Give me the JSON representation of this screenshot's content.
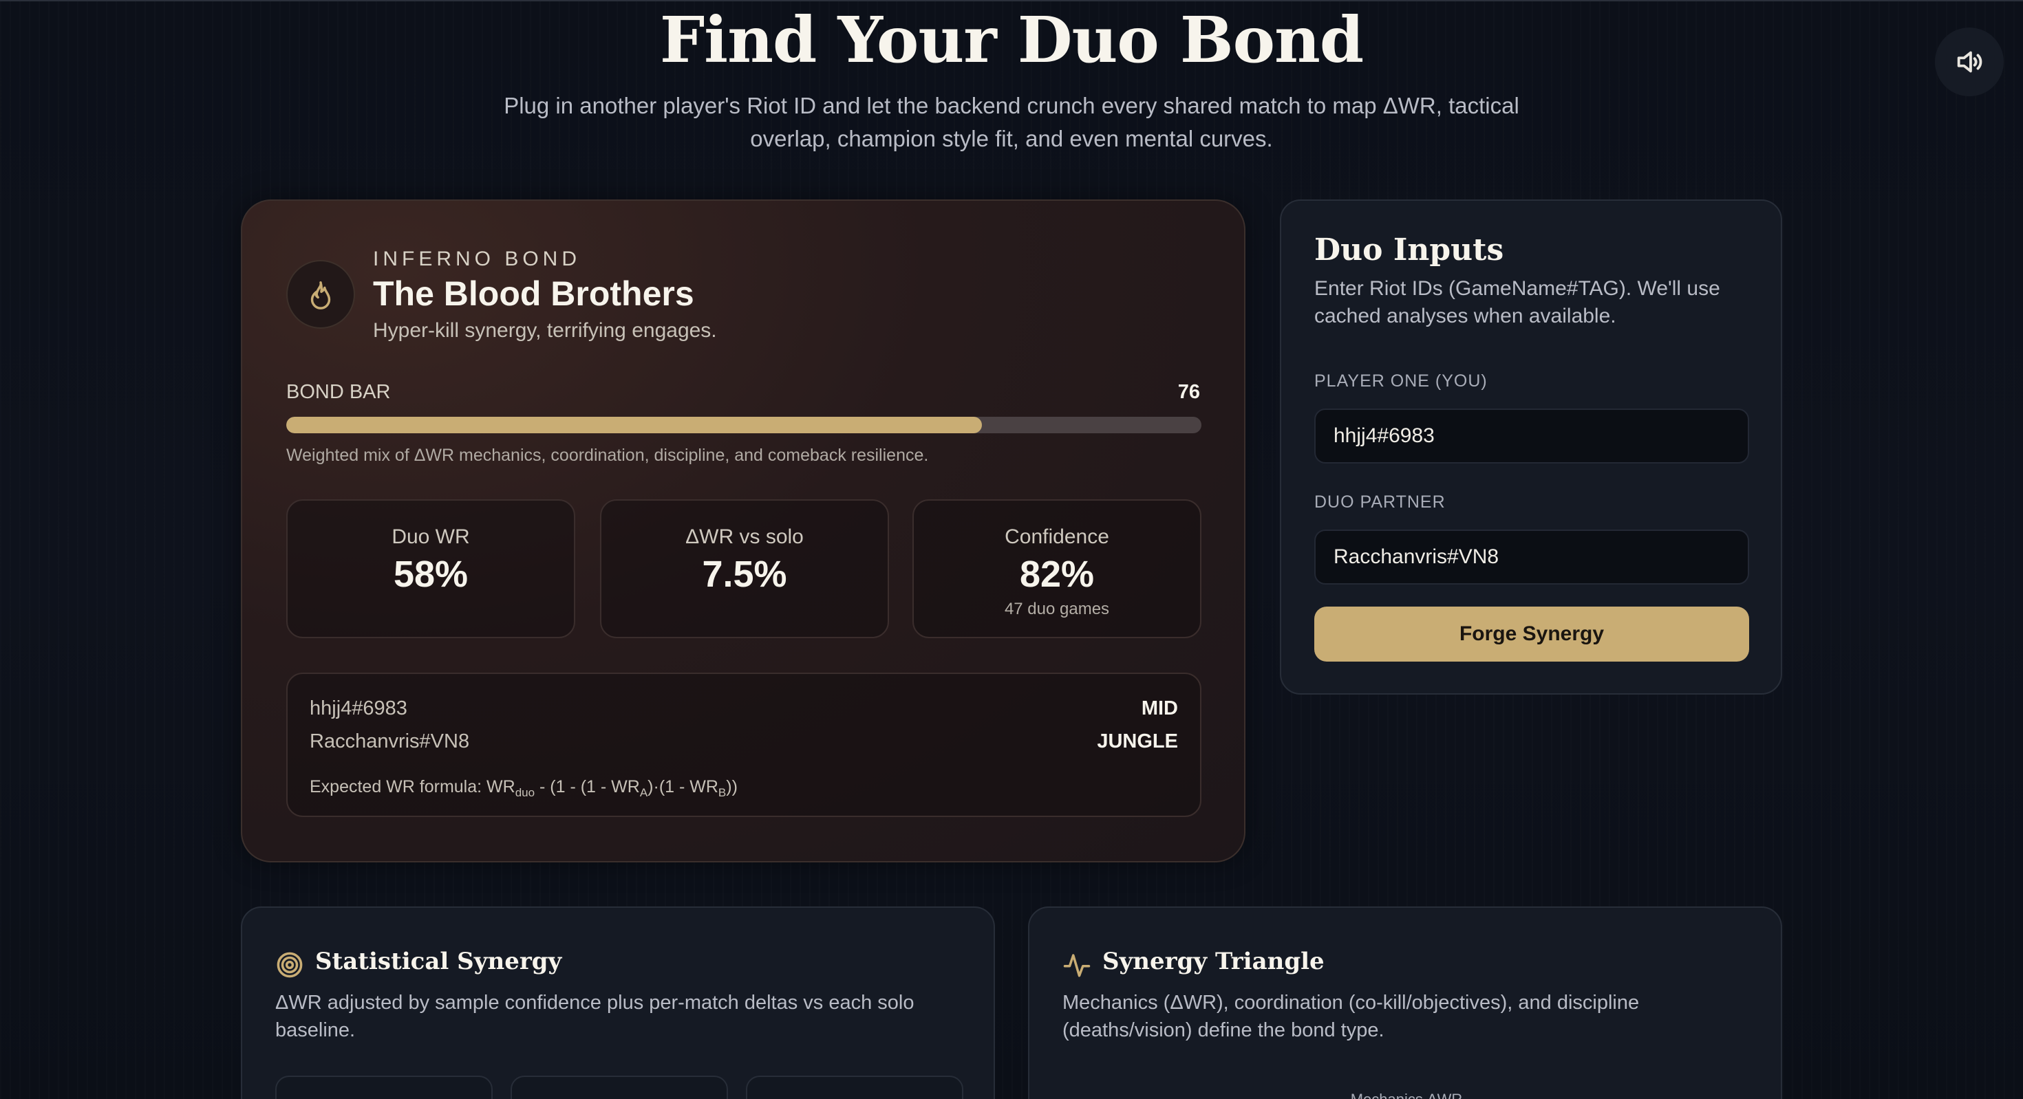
{
  "header": {
    "title": "Find Your Duo Bond",
    "subtitle": "Plug in another player's Riot ID and let the backend crunch every shared match to map ΔWR, tactical overlap, champion style fit, and even mental curves."
  },
  "sound_icon": "speaker-icon",
  "bond": {
    "tier": "INFERNO BOND",
    "name": "The Blood Brothers",
    "tagline": "Hyper-kill synergy, terrifying engages.",
    "icon": "flame-icon",
    "bar_label": "BOND BAR",
    "bar_value": "76",
    "bar_fraction": 0.76,
    "bar_note": "Weighted mix of ΔWR mechanics, coordination, discipline, and comeback resilience.",
    "stats": [
      {
        "label": "Duo WR",
        "value": "58%",
        "sub": ""
      },
      {
        "label": "ΔWR vs solo",
        "value": "7.5%",
        "sub": ""
      },
      {
        "label": "Confidence",
        "value": "82%",
        "sub": "47 duo games"
      }
    ],
    "players": [
      {
        "name": "hhjj4#6983",
        "role": "MID"
      },
      {
        "name": "Racchanvris#VN8",
        "role": "JUNGLE"
      }
    ],
    "formula": {
      "prefix": "Expected WR formula: WR",
      "sub_duo": "duo",
      "mid1": " - (1 - (1 - WR",
      "sub_a": "A",
      "mid2": ")·(1 - WR",
      "sub_b": "B",
      "suffix": "))"
    }
  },
  "inputs": {
    "title": "Duo Inputs",
    "description": "Enter Riot IDs (GameName#TAG). We'll use cached analyses when available.",
    "player_one_label": "PLAYER ONE (YOU)",
    "player_one_value": "hhjj4#6983",
    "partner_label": "DUO PARTNER",
    "partner_value": "Racchanvris#VN8",
    "button_label": "Forge Synergy"
  },
  "panels": {
    "statistical": {
      "title": "Statistical Synergy",
      "description": "ΔWR adjusted by sample confidence plus per-match deltas vs each solo baseline.",
      "icon": "target-icon"
    },
    "triangle": {
      "title": "Synergy Triangle",
      "description": "Mechanics (ΔWR), coordination (co-kill/objectives), and discipline (deaths/vision) define the bond type.",
      "icon": "pulse-icon",
      "axis_top": "Mechanics ΔWR"
    }
  },
  "colors": {
    "accent_gold": "#c9ad74",
    "background": "#0d111a",
    "card_ember": "#261a1b"
  }
}
